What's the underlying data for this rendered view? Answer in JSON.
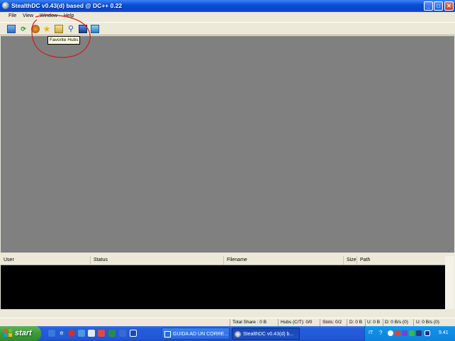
{
  "window": {
    "title": "StealthDC v0.43(d) based @ DC++  0.22",
    "minimize_glyph": "_",
    "maximize_glyph": "□",
    "close_glyph": "✕"
  },
  "menu": {
    "items": [
      "File",
      "View",
      "Window",
      "Help"
    ]
  },
  "toolbar": {
    "buttons": [
      {
        "name": "public-hubs-icon"
      },
      {
        "name": "reconnect-icon"
      },
      {
        "name": "follow-redirect-icon"
      },
      {
        "name": "favorite-hubs-icon"
      },
      {
        "name": "favorite-users-icon"
      },
      {
        "name": "search-icon"
      },
      {
        "name": "search-spy-icon"
      },
      {
        "name": "notepad-icon"
      }
    ],
    "tooltip": "Favorite Hubs"
  },
  "transfers": {
    "columns": [
      "User",
      "Status",
      "Filename",
      "Size",
      "Path"
    ]
  },
  "statusbar": {
    "total_share": "Total Share : 0 B",
    "hubs": "Hubs (C/T): 0/0",
    "slots": "Slots: 0/2",
    "down": "D: 0 B",
    "up": "U: 0 B",
    "down_rate": "D: 0 B/s (0)",
    "up_rate": "U: 0 B/s (0)"
  },
  "taskbar": {
    "start_label": "start",
    "tasks": [
      {
        "label": "GUIDA AD UN CORRE...",
        "active": false
      },
      {
        "label": "StealthDC v0.43(d) b...",
        "active": true
      }
    ],
    "language": "IT",
    "clock": "9.41"
  },
  "colors": {
    "mdi_background": "#808080",
    "transfer_list_background": "#000000",
    "annotation": "#d11a1a",
    "taskbar_blue": "#245edb",
    "start_green": "#3c9a3a"
  }
}
